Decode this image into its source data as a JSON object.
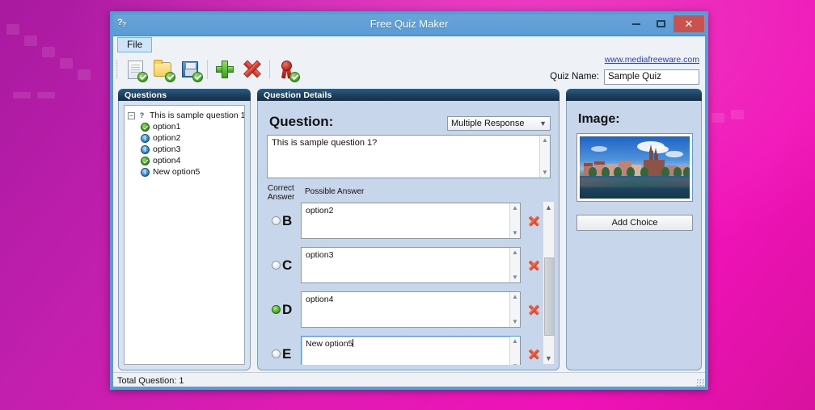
{
  "window": {
    "title": "Free Quiz Maker",
    "icon": "quiz-app-icon",
    "minimize_label": "–",
    "maximize_label": "□",
    "close_label": "✕"
  },
  "menubar": {
    "file_label": "File"
  },
  "toolbar": {
    "icons": [
      {
        "name": "new-quiz-icon",
        "title": "New"
      },
      {
        "name": "open-quiz-icon",
        "title": "Open"
      },
      {
        "name": "save-quiz-icon",
        "title": "Save"
      },
      {
        "name": "add-question-icon",
        "title": "Add"
      },
      {
        "name": "delete-question-icon",
        "title": "Delete"
      },
      {
        "name": "publish-quiz-icon",
        "title": "Publish"
      }
    ],
    "site_link": "www.mediafreeware.com",
    "quiz_name_label": "Quiz Name:",
    "quiz_name_value": "Sample Quiz"
  },
  "questions_panel": {
    "header": "Questions",
    "root": {
      "label": "This is sample question 1?",
      "expander": "−",
      "icon": "question-node-icon"
    },
    "children": [
      {
        "label": "option1",
        "icon": "correct-check-icon"
      },
      {
        "label": "option2",
        "icon": "info-icon"
      },
      {
        "label": "option3",
        "icon": "info-icon"
      },
      {
        "label": "option4",
        "icon": "correct-check-icon"
      },
      {
        "label": "New option5",
        "icon": "info-icon"
      }
    ]
  },
  "details_panel": {
    "header": "Question Details",
    "question_label": "Question:",
    "question_type": "Multiple Response",
    "question_text": "This is sample question 1?",
    "correct_answer_header_line1": "Correct",
    "correct_answer_header_line2": "Answer",
    "possible_answer_header": "Possible Answer",
    "answers": [
      {
        "letter": "B",
        "text": "option2",
        "selected": false,
        "focused": false
      },
      {
        "letter": "C",
        "text": "option3",
        "selected": false,
        "focused": false
      },
      {
        "letter": "D",
        "text": "option4",
        "selected": true,
        "focused": false
      },
      {
        "letter": "E",
        "text": "New option5",
        "selected": false,
        "focused": true
      }
    ],
    "delete_icon": "delete-answer-icon",
    "scroll_up": "▲",
    "scroll_down": "▼"
  },
  "image_panel": {
    "header_label": "Image:",
    "thumbnail_alt": "city-riverfront-photo",
    "add_choice_label": "Add Choice"
  },
  "statusbar": {
    "total_questions": "Total Question: 1"
  },
  "colors": {
    "titlebar": "#5b9bd5",
    "close_button": "#c9524f",
    "panel_header": "#1d3f5c",
    "panel_background": "#c7d6ea",
    "questions_background": "#d6e2f0",
    "link": "#2b3ec9",
    "correct_radio": "#2f9216",
    "delete_x": "#d63b17",
    "desktop": "#e01bb4"
  }
}
